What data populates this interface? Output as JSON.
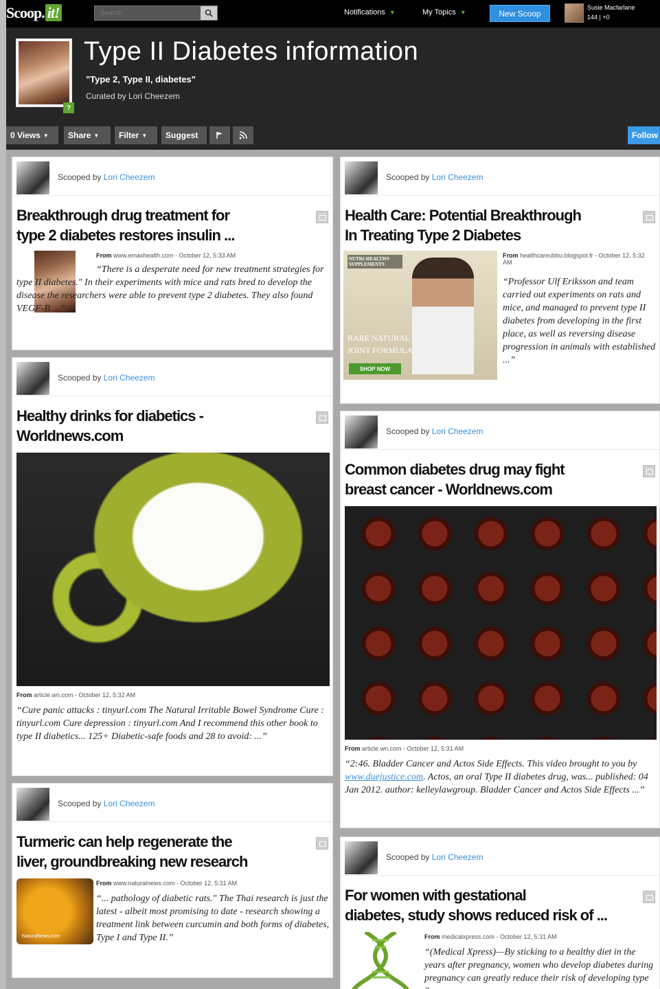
{
  "topbar": {
    "logo_text": "Scoop.",
    "logo_it": "it!",
    "search_placeholder": "Search",
    "notifications": "Notifications",
    "my_topics": "My Topics",
    "new_scoop": "New Scoop",
    "user_name": "Susie Macfarlane",
    "user_stats": "144 | +0"
  },
  "header": {
    "title": "Type II Diabetes information",
    "subtitle": "\"Type 2, Type II, diabetes\"",
    "curated_by": "Curated by Lori Cheezem",
    "badge": "?",
    "toolbar": {
      "views": "0 Views",
      "share": "Share",
      "filter": "Filter",
      "suggest": "Suggest",
      "follow": "Follow"
    }
  },
  "cards": [
    {
      "scooped_by": "Scooped by",
      "author": "Lori Cheezem",
      "title_line1": "Breakthrough drug treatment for",
      "title_line2": "type 2 diabetes restores insulin ...",
      "from_prefix": "From",
      "from_source": "www.emaxhealth.com - October 12, 5:33 AM",
      "quote": "“There is a desperate need for new treatment strategies for type II diabetes.\" In their experiments with mice and rats bred to develop the disease the researchers were able to prevent type 2 diabetes. They also found VEGF-B ...”"
    },
    {
      "scooped_by": "Scooped by",
      "author": "Lori Cheezem",
      "title_line1": "Health Care: Potential Breakthrough",
      "title_line2": "In Treating Type 2 Diabetes",
      "from_prefix": "From",
      "from_source": "healthcareubbu.blogspot.fr - October 12, 5:32 AM",
      "quote": "“Professor Ulf Eriksson and team carried out experiments on rats and mice, and managed to prevent type II diabetes from developing in the first place, as well as reversing disease progression in animals with established ...”",
      "ad_line1": "NUTRI-HEALTH® SUPPLEMENTS",
      "ad_line2": "RARE NATURAL JOINT FORMULA",
      "ad_cta": "SHOP NOW"
    },
    {
      "scooped_by": "Scooped by",
      "author": "Lori Cheezem",
      "title_line1": "Healthy drinks for diabetics -",
      "title_line2": "Worldnews.com",
      "from_prefix": "From",
      "from_source": "article.wn.com - October 12, 5:32 AM",
      "quote": "“Cure panic attacks : tinyurl.com The Natural Irritable Bowel Syndrome Cure : tinyurl.com Cure depression : tinyurl.com And I recommend this other book to type II diabetics... 125+ Diabetic-safe foods and 28 to avoid: ...”"
    },
    {
      "scooped_by": "Scooped by",
      "author": "Lori Cheezem",
      "title_line1": "Common diabetes drug may fight",
      "title_line2": "breast cancer - Worldnews.com",
      "from_prefix": "From",
      "from_source": "article.wn.com - October 12, 5:31 AM",
      "quote_pre": "“2:46. Bladder Cancer and Actos Side Effects. This video brought to you by ",
      "quote_link": "www.duejustice.com",
      "quote_post": ". Actos, an oral Type II diabetes drug, was... published: 04 Jan 2012. author: kelleylawgroup. Bladder Cancer and Actos Side Effects ...”"
    },
    {
      "scooped_by": "Scooped by",
      "author": "Lori Cheezem",
      "title_line1": "Turmeric can help regenerate the",
      "title_line2": "liver, groundbreaking new research",
      "from_prefix": "From",
      "from_source": "www.naturalnews.com - October 12, 5:31 AM",
      "quote": "“... pathology of diabetic rats.\" The Thai research is just the latest - albeit most promising to date - research showing a treatment link between curcumin and both forms of diabetes, Type I and Type II.”",
      "img_caption": "NaturalNews.com"
    },
    {
      "scooped_by": "Scooped by",
      "author": "Lori Cheezem",
      "title_line1": "For women with gestational",
      "title_line2": "diabetes, study shows reduced risk of ...",
      "from_prefix": "From",
      "from_source": "medicalxpress.com - October 12, 5:31 AM",
      "quote": "“(Medical Xpress)—By sticking to a healthy diet in the years after pregnancy, women who develop diabetes during pregnancy can greatly reduce their risk of developing type 2"
    }
  ]
}
